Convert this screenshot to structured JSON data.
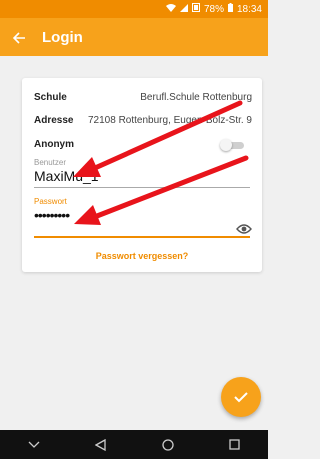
{
  "status_bar": {
    "battery_percent": "78%",
    "time": "18:34"
  },
  "app_bar": {
    "title": "Login"
  },
  "form": {
    "school": {
      "label": "Schule",
      "value": "Berufl.Schule Rottenburg"
    },
    "address": {
      "label": "Adresse",
      "value": "72108 Rottenburg, Eugen-Bolz-Str. 9"
    },
    "anonymous": {
      "label": "Anonym",
      "enabled": false
    },
    "username": {
      "label": "Benutzer",
      "value": "MaxiMu_1"
    },
    "password": {
      "label": "Passwort",
      "value": "•••••••••"
    },
    "forgot_password": "Passwort vergessen?"
  },
  "colors": {
    "accent": "#f7a21b",
    "status_bar": "#f08c00",
    "annotation_arrow": "#e8141b"
  },
  "icons": {
    "back": "arrow-left-icon",
    "eye": "eye-icon",
    "fab": "check-icon"
  }
}
